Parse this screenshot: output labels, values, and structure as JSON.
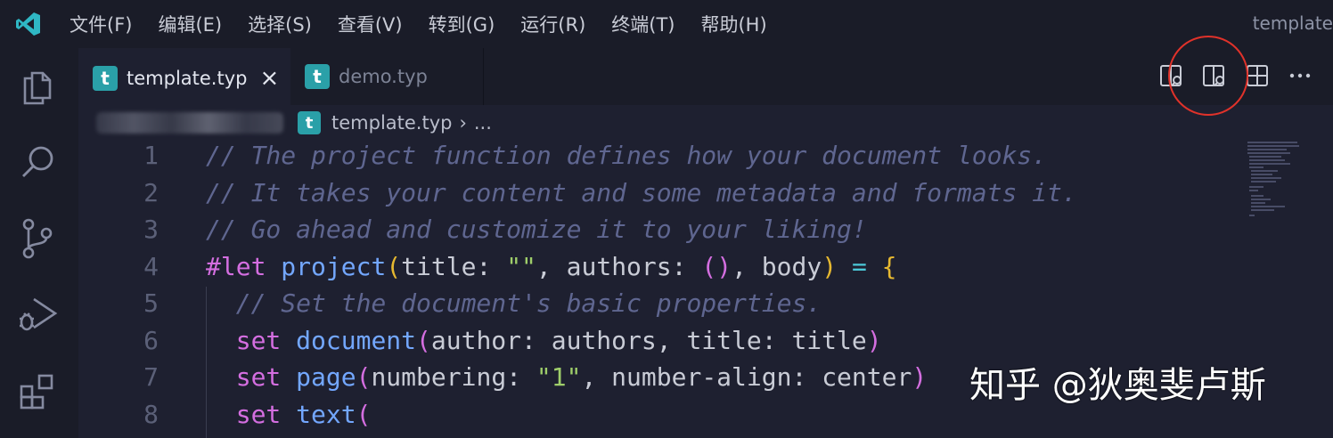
{
  "menubar": {
    "items": [
      "文件(F)",
      "编辑(E)",
      "选择(S)",
      "查看(V)",
      "转到(G)",
      "运行(R)",
      "终端(T)",
      "帮助(H)"
    ],
    "window_title": "template"
  },
  "activity_bar": {
    "icons": [
      "files-icon",
      "search-icon",
      "source-control-icon",
      "run-debug-icon",
      "extensions-icon"
    ]
  },
  "tabs": [
    {
      "label": "template.typ",
      "icon_letter": "t",
      "active": true
    },
    {
      "label": "demo.typ",
      "icon_letter": "t",
      "active": false
    }
  ],
  "tab_actions": [
    "open-preview-icon",
    "open-preview-side-icon",
    "split-editor-icon",
    "more-actions-icon"
  ],
  "breadcrumb": {
    "icon_letter": "t",
    "file": "template.typ",
    "separator": "›",
    "more": "..."
  },
  "editor": {
    "lines": [
      {
        "n": "1",
        "tokens": [
          {
            "c": "cm",
            "t": "// The project function defines how your document looks."
          }
        ]
      },
      {
        "n": "2",
        "tokens": [
          {
            "c": "cm",
            "t": "// It takes your content and some metadata and formats it."
          }
        ]
      },
      {
        "n": "3",
        "tokens": [
          {
            "c": "cm",
            "t": "// Go ahead and customize it to your liking!"
          }
        ]
      },
      {
        "n": "4",
        "tokens": [
          {
            "c": "kw",
            "t": "#let"
          },
          {
            "c": "pl",
            "t": " "
          },
          {
            "c": "fn",
            "t": "project"
          },
          {
            "c": "pa",
            "t": "("
          },
          {
            "c": "pl",
            "t": "title: "
          },
          {
            "c": "st",
            "t": "\"\""
          },
          {
            "c": "pl",
            "t": ", authors: "
          },
          {
            "c": "pa2",
            "t": "()"
          },
          {
            "c": "pl",
            "t": ", body"
          },
          {
            "c": "pa",
            "t": ")"
          },
          {
            "c": "pl",
            "t": " "
          },
          {
            "c": "op",
            "t": "="
          },
          {
            "c": "pl",
            "t": " "
          },
          {
            "c": "pa",
            "t": "{"
          }
        ]
      },
      {
        "n": "5",
        "tokens": [
          {
            "c": "cm",
            "t": "  // Set the document's basic properties."
          }
        ]
      },
      {
        "n": "6",
        "tokens": [
          {
            "c": "kw",
            "t": "  set"
          },
          {
            "c": "pl",
            "t": " "
          },
          {
            "c": "fn",
            "t": "document"
          },
          {
            "c": "pa2",
            "t": "("
          },
          {
            "c": "pl",
            "t": "author: authors, title: title"
          },
          {
            "c": "pa2",
            "t": ")"
          }
        ]
      },
      {
        "n": "7",
        "tokens": [
          {
            "c": "kw",
            "t": "  set"
          },
          {
            "c": "pl",
            "t": " "
          },
          {
            "c": "fn",
            "t": "page"
          },
          {
            "c": "pa2",
            "t": "("
          },
          {
            "c": "pl",
            "t": "numbering: "
          },
          {
            "c": "st",
            "t": "\"1\""
          },
          {
            "c": "pl",
            "t": ", number-align: center"
          },
          {
            "c": "pa2",
            "t": ")"
          }
        ]
      },
      {
        "n": "8",
        "tokens": [
          {
            "c": "kw",
            "t": "  set"
          },
          {
            "c": "pl",
            "t": " "
          },
          {
            "c": "fn",
            "t": "text"
          },
          {
            "c": "pa2",
            "t": "("
          }
        ]
      }
    ]
  },
  "watermark": "知乎 @狄奥斐卢斯",
  "colors": {
    "background": "#1e2030",
    "chrome": "#1a1c28",
    "typst_icon": "#2aa0a8",
    "highlight_circle": "#e0322a"
  }
}
